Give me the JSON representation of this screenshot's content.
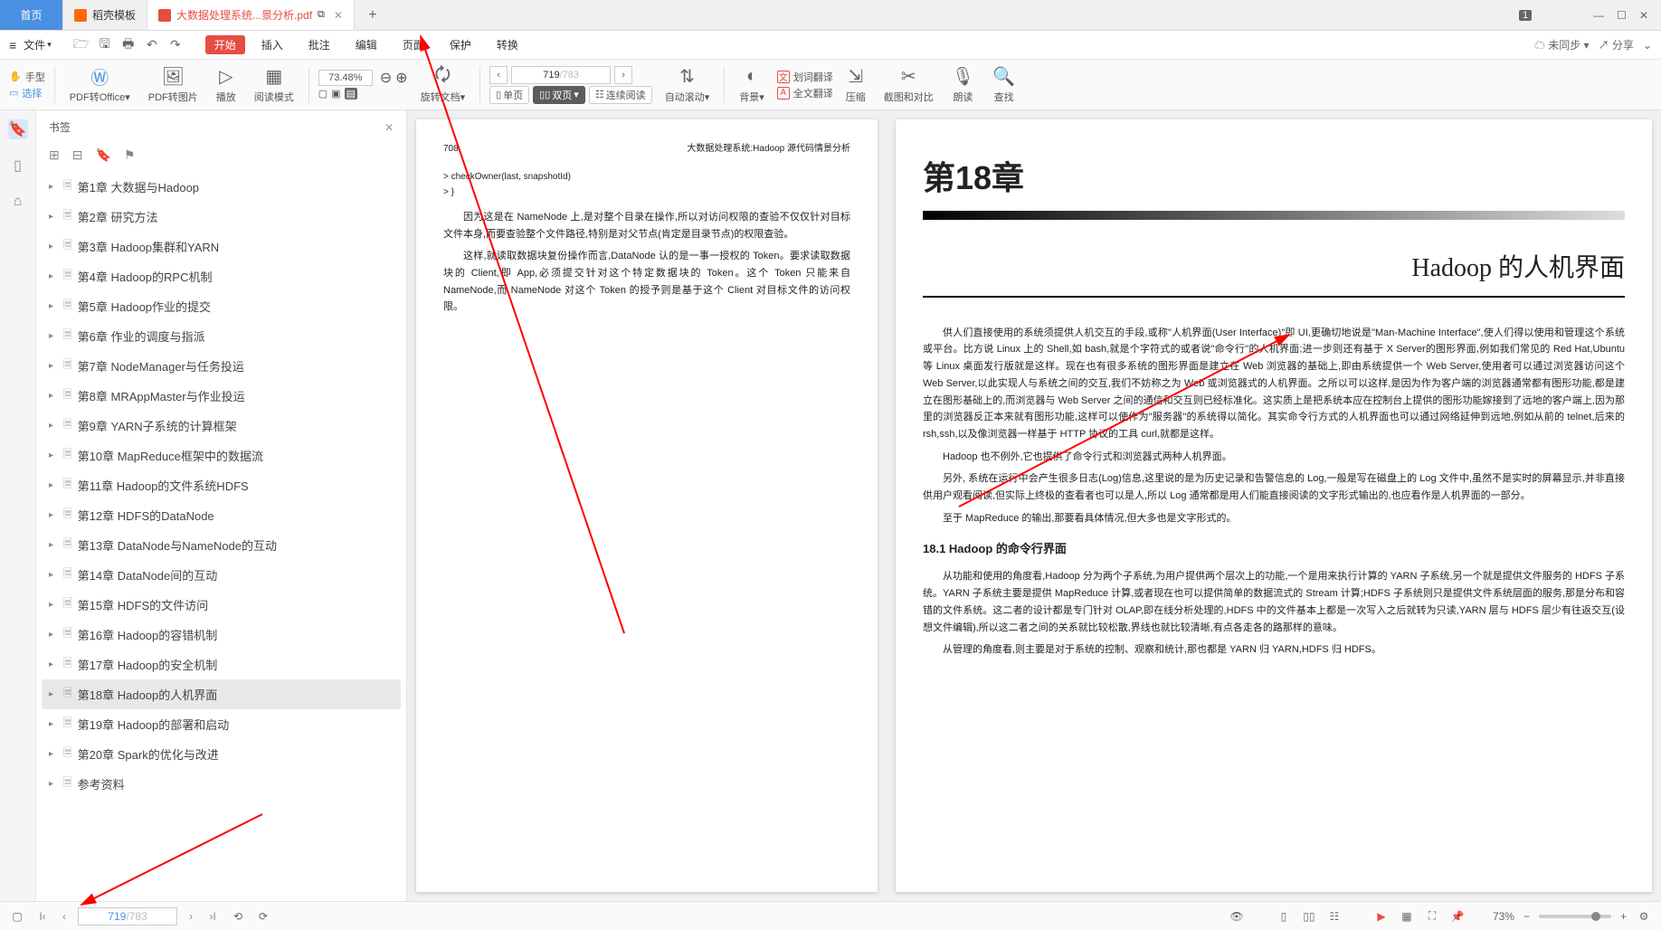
{
  "tabs": {
    "home": "首页",
    "docker": "稻壳模板",
    "active": "大数据处理系统...景分析.pdf",
    "count_badge": "1"
  },
  "menubar": {
    "file": "文件",
    "items": [
      "开始",
      "插入",
      "批注",
      "编辑",
      "页面",
      "保护",
      "转换"
    ],
    "sync": "未同步 ▾",
    "share": "分享"
  },
  "toolbar": {
    "hand": "手型",
    "select": "选择",
    "pdf_office": "PDF转Office",
    "pdf_img": "PDF转图片",
    "play": "播放",
    "read_mode": "阅读模式",
    "zoom_val": "73.48%",
    "rotate": "旋转文档",
    "single": "单页",
    "double": "双页",
    "continuous": "连续阅读",
    "auto_scroll": "自动滚动",
    "background": "背景",
    "word_trans": "划词翻译",
    "full_trans": "全文翻译",
    "compress": "压缩",
    "screenshot": "截图和对比",
    "read_aloud": "朗读",
    "find": "查找",
    "page_current": "719",
    "page_total": "/783"
  },
  "bookmarks": {
    "title": "书签",
    "items": [
      "第1章  大数据与Hadoop",
      "第2章  研究方法",
      "第3章  Hadoop集群和YARN",
      "第4章  Hadoop的RPC机制",
      "第5章  Hadoop作业的提交",
      "第6章  作业的调度与指派",
      "第7章  NodeManager与任务投运",
      "第8章  MRAppMaster与作业投运",
      "第9章  YARN子系统的计算框架",
      "第10章  MapReduce框架中的数据流",
      "第11章  Hadoop的文件系统HDFS",
      "第12章  HDFS的DataNode",
      "第13章  DataNode与NameNode的互动",
      "第14章  DataNode间的互动",
      "第15章  HDFS的文件访问",
      "第16章  Hadoop的容错机制",
      "第17章  Hadoop的安全机制",
      "第18章  Hadoop的人机界面",
      "第19章  Hadoop的部署和启动",
      "第20章  Spark的优化与改进",
      "参考资料"
    ],
    "selected_index": 17
  },
  "left_page": {
    "num": "708",
    "header": "大数据处理系统:Hadoop 源代码情景分析",
    "code1": ">  checkOwner(last, snapshotId)",
    "code2": "> }",
    "p1": "因为这是在 NameNode 上,是对整个目录在操作,所以对访问权限的查验不仅仅针对目标文件本身,而要查验整个文件路径,特别是对父节点(肯定是目录节点)的权限查验。",
    "p2": "这样,就读取数据块复份操作而言,DataNode 认的是一事一授权的 Token。要求读取数据块的 Client,即 App,必须提交针对这个特定数据块的 Token。这个 Token 只能来自 NameNode,而 NameNode 对这个 Token 的授予则是基于这个 Client 对目标文件的访问权限。"
  },
  "right_page": {
    "chapter": "第18章",
    "title": "Hadoop 的人机界面",
    "p1": "供人们直接使用的系统须提供人机交互的手段,或称\"人机界面(User Interface)\"即 UI,更确切地说是\"Man-Machine Interface\",使人们得以使用和管理这个系统或平台。比方说 Linux 上的 Shell,如 bash,就是个字符式的或者说\"命令行\"的人机界面;进一步则还有基于 X Server的图形界面,例如我们常见的 Red Hat,Ubuntu 等 Linux 桌面发行版就是这样。现在也有很多系统的图形界面是建立在 Web 浏览器的基础上,即由系统提供一个 Web Server,使用者可以通过浏览器访问这个 Web Server,以此实现人与系统之间的交互,我们不妨称之为 Web 或浏览器式的人机界面。之所以可以这样,是因为作为客户端的浏览器通常都有图形功能,都是建立在图形基础上的,而浏览器与 Web Server 之间的通信和交互则已经标准化。这实质上是把系统本应在控制台上提供的图形功能嫁接到了远地的客户端上,因为那里的浏览器反正本来就有图形功能,这样可以使作为\"服务器\"的系统得以简化。其实命令行方式的人机界面也可以通过网络延伸到远地,例如从前的 telnet,后来的 rsh,ssh,以及像浏览器一样基于 HTTP 协议的工具 curl,就都是这样。",
    "p2": "Hadoop 也不例外,它也提供了命令行式和浏览器式两种人机界面。",
    "p3": "另外, 系统在运行中会产生很多日志(Log)信息,这里说的是为历史记录和告警信息的 Log,一般是写在磁盘上的 Log 文件中,虽然不是实时的屏幕显示,并非直接供用户观看阅读,但实际上终极的查看者也可以是人,所以 Log 通常都是用人们能直接阅读的文字形式输出的,也应看作是人机界面的一部分。",
    "p4": "至于 MapReduce 的输出,那要看具体情况,但大多也是文字形式的。",
    "sec": "18.1  Hadoop 的命令行界面",
    "p5": "从功能和使用的角度看,Hadoop 分为两个子系统,为用户提供两个层次上的功能,一个是用来执行计算的 YARN 子系统,另一个就是提供文件服务的 HDFS 子系统。YARN 子系统主要是提供 MapReduce 计算,或者现在也可以提供简单的数据流式的 Stream 计算;HDFS 子系统则只是提供文件系统层面的服务,那是分布和容错的文件系统。这二者的设计都是专门针对 OLAP,即在线分析处理的,HDFS 中的文件基本上都是一次写入之后就转为只读,YARN 层与 HDFS 层少有往返交互(设想文件编辑),所以这二者之间的关系就比较松散,界线也就比较清晰,有点各走各的路那样的意味。",
    "p6": "从管理的角度看,则主要是对于系统的控制、观察和统计,那也都是 YARN 归 YARN,HDFS 归 HDFS。"
  },
  "statusbar": {
    "page_current": "719",
    "page_total": "/783",
    "zoom": "73%"
  }
}
